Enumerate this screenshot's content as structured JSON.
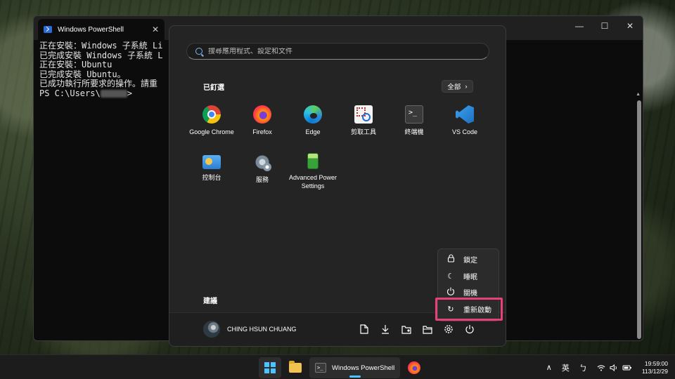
{
  "powershell": {
    "tab_title": "Windows PowerShell",
    "tab_close": "✕",
    "controls": {
      "minimize": "—",
      "maximize": "☐",
      "close": "✕"
    },
    "lines": [
      "正在安裝：Windows 子系統 Li",
      "已完成安裝 Windows 子系統 L",
      "正在安裝：Ubuntu",
      "已完成安裝 Ubuntu。",
      "已成功執行所要求的操作。請重"
    ],
    "prompt_prefix": "PS C:\\Users\\",
    "prompt_suffix": ">"
  },
  "start": {
    "search_placeholder": "搜尋應用程式、設定和文件",
    "pinned_title": "已釘選",
    "all_label": "全部",
    "all_chevron": "›",
    "apps": [
      {
        "label": "Google Chrome",
        "icon": "chrome-icon"
      },
      {
        "label": "Firefox",
        "icon": "firefox-icon"
      },
      {
        "label": "Edge",
        "icon": "edge-icon"
      },
      {
        "label": "剪取工具",
        "icon": "snipping-tool-icon"
      },
      {
        "label": "終端機",
        "icon": "terminal-icon"
      },
      {
        "label": "VS Code",
        "icon": "vscode-icon"
      },
      {
        "label": "控制台",
        "icon": "control-panel-icon"
      },
      {
        "label": "服務",
        "icon": "services-icon"
      },
      {
        "label": "Advanced Power Settings",
        "icon": "power-settings-icon"
      }
    ],
    "recommended_title": "建議",
    "user_name": "CHING HSUN CHUANG",
    "footer_icons": [
      "document-icon",
      "downloads-icon",
      "user-folder-icon",
      "explorer-icon",
      "settings-icon",
      "power-icon"
    ]
  },
  "power_menu": {
    "items": [
      {
        "label": "鎖定",
        "icon": "lock-icon",
        "glyph": "🔒︎"
      },
      {
        "label": "睡眠",
        "icon": "sleep-icon",
        "glyph": "☾"
      },
      {
        "label": "關機",
        "icon": "power-icon",
        "glyph": "⏻"
      },
      {
        "label": "重新啟動",
        "icon": "restart-icon",
        "glyph": "↻"
      }
    ],
    "highlight_color": "#e8407a"
  },
  "taskbar": {
    "ps_label": "Windows PowerShell",
    "ime_lang": "英",
    "ime_mode": "ㄅ",
    "overflow": "∧",
    "time": "19:59:00",
    "date": "113/12/29"
  },
  "colors": {
    "accent": "#4cc2ff",
    "menu_bg": "#242424"
  }
}
